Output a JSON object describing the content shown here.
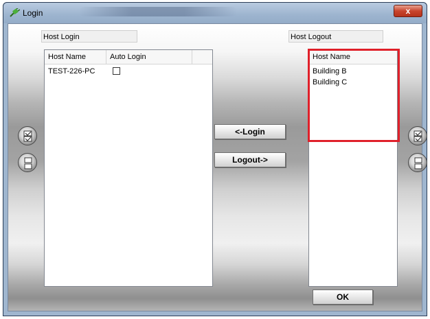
{
  "window": {
    "title": "Login",
    "close_label": "x"
  },
  "host_login": {
    "label": "Host Login",
    "columns": [
      "Host Name",
      "Auto Login"
    ],
    "rows": [
      {
        "host_name": "TEST-226-PC",
        "auto_login": false
      }
    ]
  },
  "host_logout": {
    "label": "Host Logout",
    "columns": [
      "Host Name"
    ],
    "rows": [
      "Building B",
      "Building C"
    ]
  },
  "buttons": {
    "login": "<-Login",
    "logout": "Logout->",
    "ok": "OK"
  },
  "colors": {
    "highlight": "#e0202a",
    "title_bar": "#9fb6cf"
  },
  "icons": {
    "left_select_all": "check-all-icon",
    "left_deselect_all": "uncheck-all-icon",
    "right_select_all": "check-all-icon",
    "right_deselect_all": "uncheck-all-icon",
    "title": "plug-icon"
  }
}
